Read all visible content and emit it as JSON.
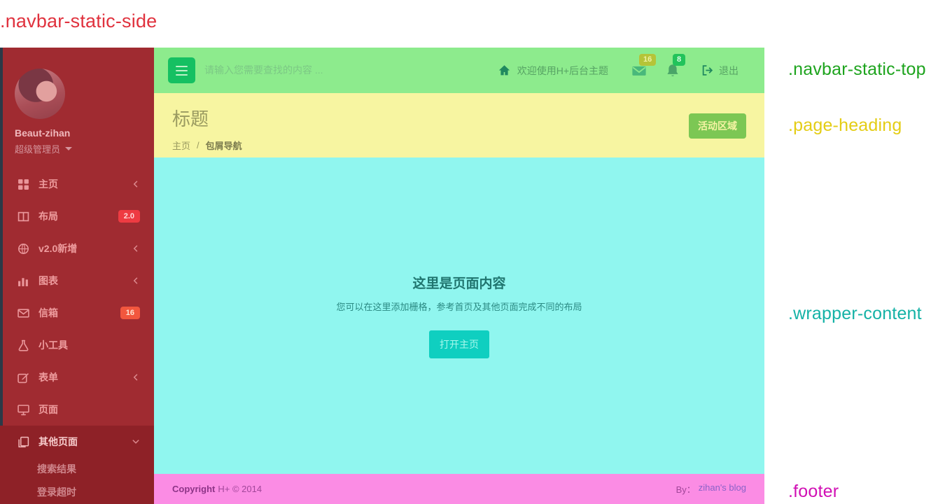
{
  "annotations": {
    "side": ".navbar-static-side",
    "top": ".navbar-static-top",
    "heading": ".page-heading",
    "content": ".wrapper-content",
    "footer": ".footer"
  },
  "sidebar": {
    "user": {
      "name": "Beaut-zihan",
      "role": "超级管理员"
    },
    "items": [
      {
        "label": "主页",
        "icon": "th-large-icon",
        "chevron": "left"
      },
      {
        "label": "布局",
        "icon": "columns-icon",
        "badge": "2.0"
      },
      {
        "label": "v2.0新增",
        "icon": "globe-icon",
        "chevron": "left"
      },
      {
        "label": "图表",
        "icon": "bar-chart-icon",
        "chevron": "left"
      },
      {
        "label": "信箱",
        "icon": "envelope-icon",
        "badge": "16"
      },
      {
        "label": "小工具",
        "icon": "flask-icon"
      },
      {
        "label": "表单",
        "icon": "edit-icon",
        "chevron": "left"
      },
      {
        "label": "页面",
        "icon": "desktop-icon"
      },
      {
        "label": "其他页面",
        "icon": "copy-icon",
        "chevron": "down",
        "active": true,
        "children": [
          "搜索结果",
          "登录超时"
        ]
      }
    ]
  },
  "topbar": {
    "search_placeholder": "请输入您需要查找的内容 ...",
    "welcome": "欢迎使用H+后台主题",
    "mail_badge": "16",
    "alert_badge": "8",
    "logout": "退出"
  },
  "page_heading": {
    "title": "标题",
    "breadcrumb_home": "主页",
    "breadcrumb_sep": "/",
    "breadcrumb_current": "包屑导航",
    "action_button": "活动区域"
  },
  "content": {
    "heading": "这里是页面内容",
    "description": "您可以在这里添加栅格，参考首页及其他页面完成不同的布局",
    "button": "打开主页"
  },
  "footer": {
    "copyright_strong": "Copyright",
    "copyright_rest": "H+ © 2014",
    "by_label": "By：",
    "by_link": "zihan's blog"
  },
  "colors": {
    "annotation_side": "#e0323e",
    "annotation_top": "#1ea41e",
    "annotation_heading": "#e4cd15",
    "annotation_content": "#14b2a6",
    "annotation_footer": "#d110b4",
    "sidebar_overlay": "#a02b31",
    "sidebar_active_bg": "#8e2127",
    "active_border_teal": "#2f9c87",
    "topbar_overlay": "#8deb8d",
    "heading_overlay": "#f7f5a1",
    "content_overlay": "#90f6ef",
    "footer_overlay": "#fb8ce4",
    "hamburger_green": "#15c062",
    "badge_layout_red": "#ee3b42",
    "badge_mailbox_orange": "#f2573e",
    "badge_mail_yellow": "#b5c438",
    "badge_alert_green": "#22c35b",
    "action_button_green": "#7cc754",
    "content_button_teal": "#0fcfc0"
  }
}
